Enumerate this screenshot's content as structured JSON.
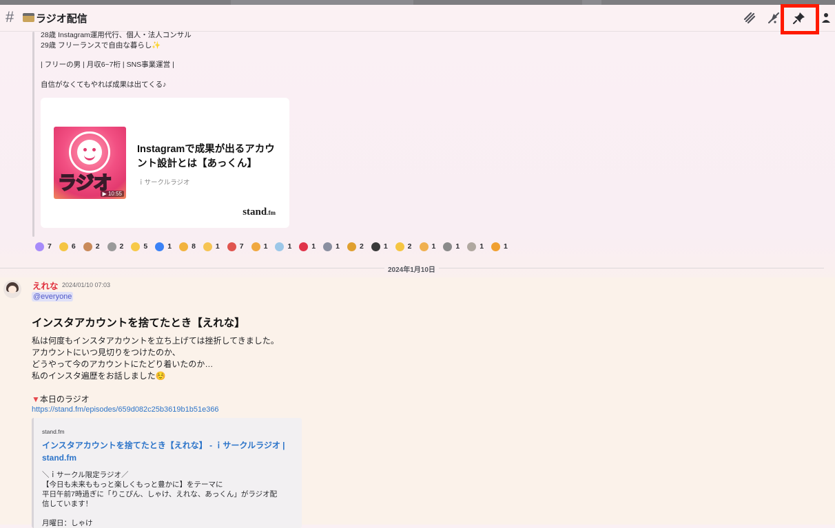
{
  "header": {
    "channel_name": "ラジオ配信",
    "hash": "#"
  },
  "message1": {
    "lines": [
      "28歳 Instagram運用代行、個人・法人コンサル",
      "29歳 フリーランスで自由な暮らし✨",
      "| フリーの男 | 月収6~7桁 | SNS事業運営 |",
      "自信がなくてもやれば成果は出てくる♪"
    ],
    "card": {
      "title": "Instagramで成果が出るアカウント設計とは【あっくん】",
      "subtitle": "ｉサークルラジオ",
      "brand": "stand",
      "brand_suffix": ".fm",
      "thumb_text": "ラジオ",
      "duration": "▶ 10:55"
    },
    "reactions": [
      {
        "count": "7",
        "color": "#a78bfa"
      },
      {
        "count": "6",
        "color": "#f5c542"
      },
      {
        "count": "2",
        "color": "#c98a5a"
      },
      {
        "count": "2",
        "color": "#9a9a9a"
      },
      {
        "count": "5",
        "color": "#f7c948"
      },
      {
        "count": "1",
        "color": "#3b82f6"
      },
      {
        "count": "8",
        "color": "#f2b33d"
      },
      {
        "count": "1",
        "color": "#f6c453"
      },
      {
        "count": "7",
        "color": "#e0554f"
      },
      {
        "count": "1",
        "color": "#f0a840"
      },
      {
        "count": "1",
        "color": "#9cc7e8"
      },
      {
        "count": "1",
        "color": "#e0344a"
      },
      {
        "count": "1",
        "color": "#8a8fa0"
      },
      {
        "count": "2",
        "color": "#e0a030"
      },
      {
        "count": "1",
        "color": "#3a3a3a"
      },
      {
        "count": "2",
        "color": "#f5c542"
      },
      {
        "count": "1",
        "color": "#f0b050"
      },
      {
        "count": "1",
        "color": "#8a8a8a"
      },
      {
        "count": "1",
        "color": "#b0a8a0"
      },
      {
        "count": "1",
        "color": "#f0a030"
      }
    ]
  },
  "divider": {
    "date": "2024年1月10日"
  },
  "message2": {
    "author": "えれな",
    "timestamp": "2024/01/10 07:03",
    "mention": "@everyone",
    "title": "インスタアカウントを捨てたとき【えれな】",
    "body": [
      "私は何度もインスタアカウントを立ち上げては挫折してきました。",
      "アカウントにいつ見切りをつけたのか、",
      "どうやって今のアカウントにたどり着いたのか…",
      "私のインスタ遍歴をお話しました☺️"
    ],
    "today_label": "本日のラジオ",
    "today_marker": "▼",
    "link": "https://stand.fm/episodes/659d082c25b3619b1b51e366",
    "embed": {
      "site": "stand.fm",
      "title": "インスタアカウントを捨てたとき【えれな】 - ｉサークルラジオ | stand.fm",
      "desc": [
        "＼ｉサークル限定ラジオ／",
        "【今日も未来ももっと楽しくもっと豊かに】をテーマに",
        "平日午前7時過ぎに「りこぴん、しゃけ、えれな、あっくん」がラジオ配",
        "信しています！",
        "",
        "月曜日：しゃけ"
      ]
    }
  },
  "colors": {
    "highlight": "#ff1a00",
    "author": "#e02f3d",
    "link": "#2c74c9"
  }
}
